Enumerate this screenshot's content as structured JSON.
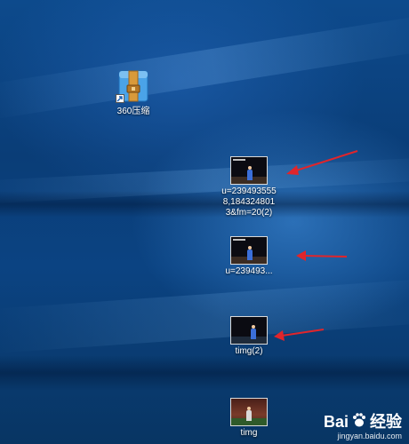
{
  "desktop": {
    "icons": [
      {
        "label": "360压缩",
        "type": "archive",
        "shortcut": true,
        "icon": "archive-zip-icon"
      },
      {
        "label": "u=2394935558,1843248013&fm=20(2)",
        "type": "image"
      },
      {
        "label": "u=239493...",
        "type": "image"
      },
      {
        "label": "timg(2)",
        "type": "image"
      },
      {
        "label": "timg",
        "type": "image"
      }
    ],
    "annotation_color": "#e0252b"
  },
  "watermark": {
    "brand_text": "Bai",
    "brand_suffix": "经验",
    "site": "jingyan.baidu.com",
    "icon": "baidu-paw-icon"
  }
}
